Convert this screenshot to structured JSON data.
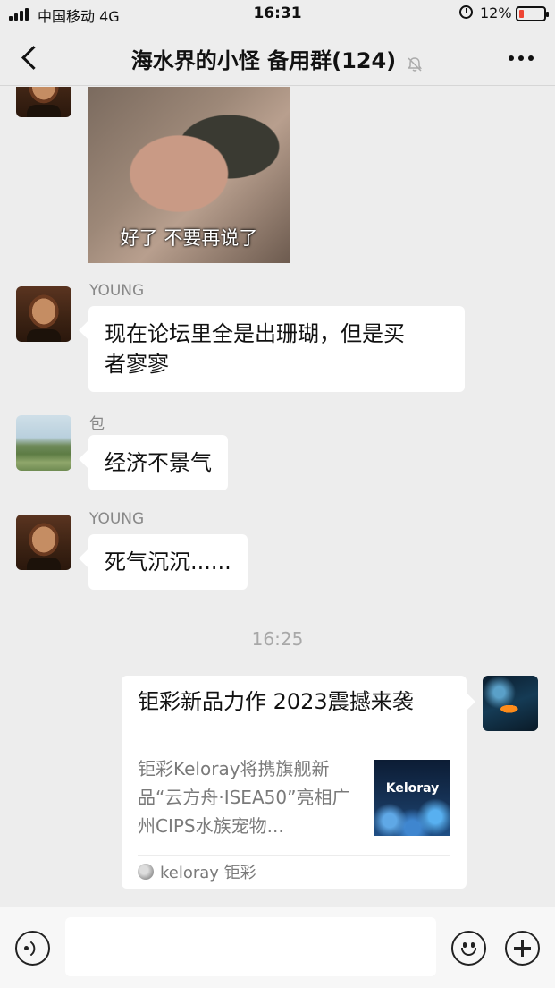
{
  "status_bar": {
    "carrier": "中国移动  4G",
    "time": "16:31",
    "battery": "12%"
  },
  "nav": {
    "title": "海水界的小怪 备用群(124)",
    "back_icon": "chevron-left-icon",
    "mute_icon": "bell-off-icon",
    "more_icon": "ellipsis-icon"
  },
  "messages": [
    {
      "type": "image",
      "sender": "",
      "caption": "好了 不要再说了"
    },
    {
      "type": "text",
      "sender": "YOUNG",
      "text_lines": [
        "现在论坛里全是出珊瑚，但是买",
        "者寥寥"
      ]
    },
    {
      "type": "text",
      "sender": "包",
      "text": "经济不景气"
    },
    {
      "type": "text",
      "sender": "YOUNG",
      "text": "死气沉沉......"
    }
  ],
  "timestamp": "16:25",
  "link_card": {
    "title": "钜彩新品力作 2023震撼来袭",
    "description": "钜彩Keloray将携旗舰新品“云方舟·ISEA50”亮相广州CIPS水族宠物...",
    "thumb_text": "Keloray",
    "source": "keloray 钜彩"
  },
  "input_bar": {
    "voice_icon": "voice-icon",
    "emoji_icon": "emoji-icon",
    "plus_icon": "plus-icon"
  }
}
